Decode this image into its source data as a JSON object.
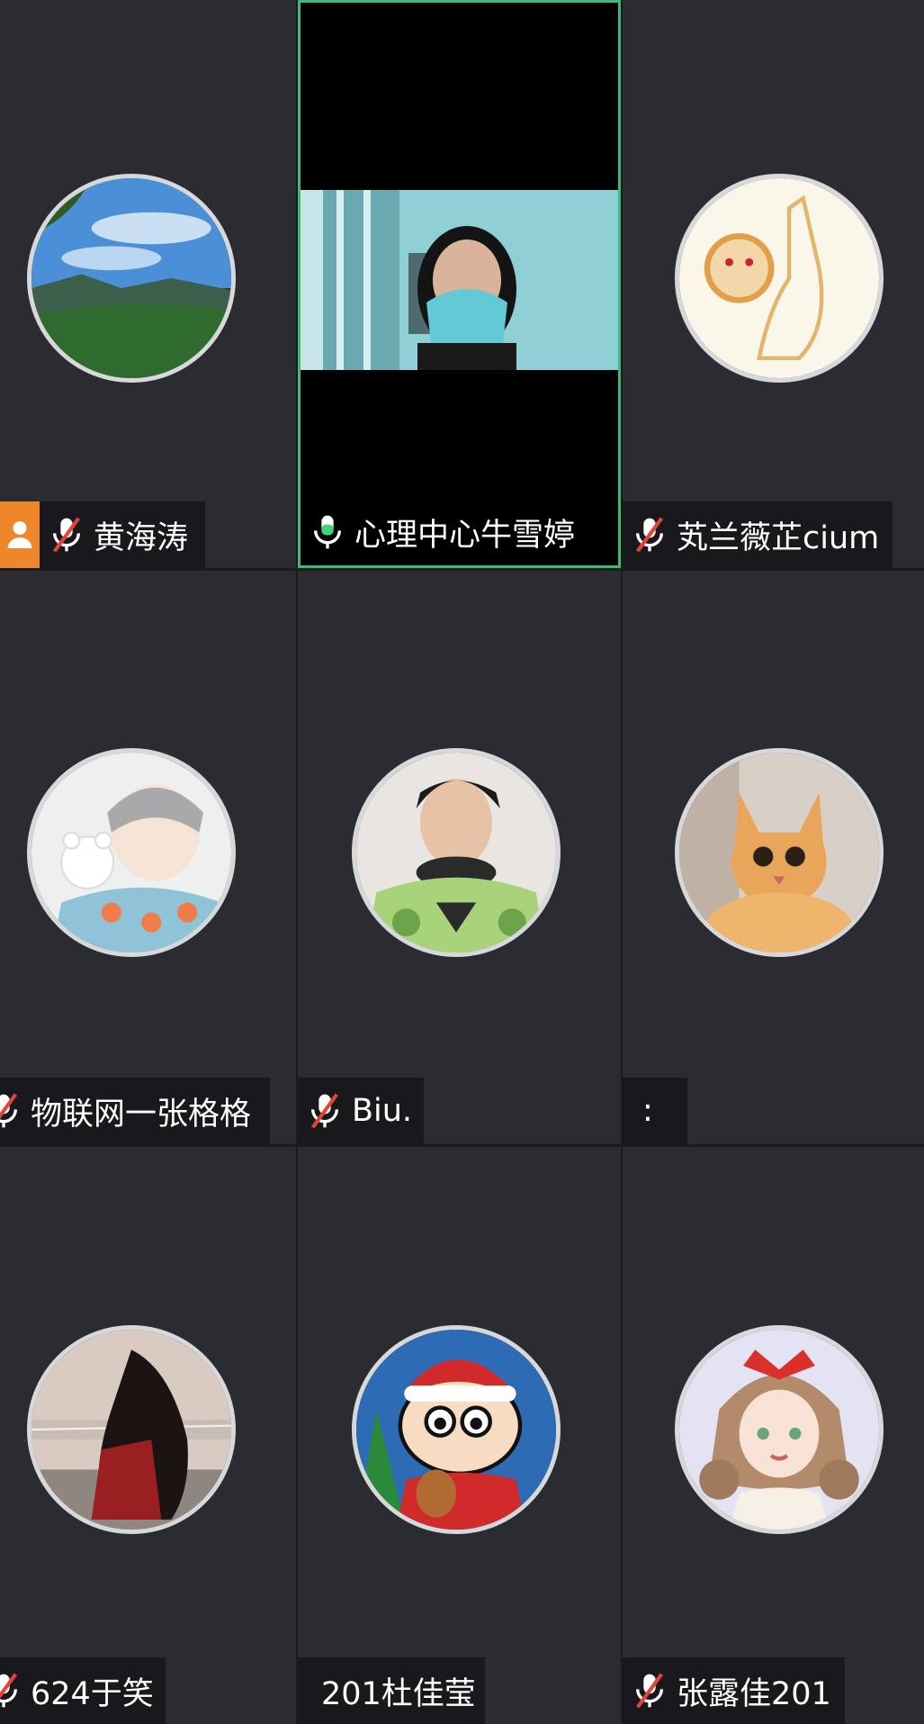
{
  "participants": [
    {
      "name": "黄海涛",
      "mic": "muted",
      "host_badge": true,
      "avatar": "mountain-landscape-avatar"
    },
    {
      "name": "心理中心牛雪婷",
      "mic": "active",
      "video_on": true,
      "active_speaker": true
    },
    {
      "name": "芄兰薇芷cium",
      "mic": "muted",
      "avatar": "cartoon-drawing-avatar"
    },
    {
      "name": "物联网一张格格",
      "mic": "muted",
      "avatar": "anime-boy-bear-avatar"
    },
    {
      "name": "Biu.",
      "mic": "muted",
      "avatar": "young-man-photo-avatar"
    },
    {
      "name": ":",
      "mic": "none",
      "avatar": "orange-cat-avatar"
    },
    {
      "name": "624于笑",
      "mic": "muted",
      "avatar": "girl-photo-avatar"
    },
    {
      "name": "201杜佳莹",
      "mic": "none",
      "avatar": "cartoon-boy-christmas-avatar"
    },
    {
      "name": "张露佳201",
      "mic": "muted",
      "avatar": "anime-girl-bow-avatar"
    }
  ],
  "colors": {
    "tile_bg": "#2b2c31",
    "active_border": "#3fb878",
    "host_badge": "#f0862a",
    "mic_muted_slash": "#e0453a",
    "mic_active": "#3fd67a"
  }
}
